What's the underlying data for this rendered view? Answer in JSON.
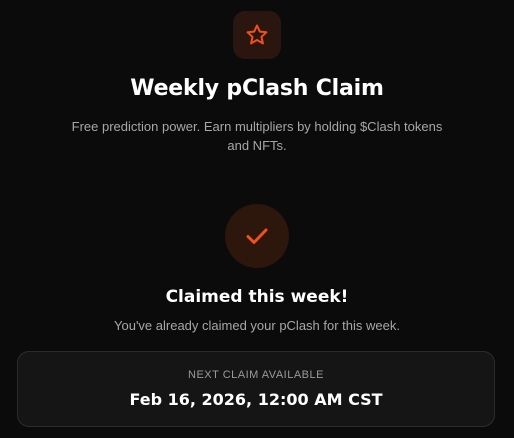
{
  "header": {
    "icon": "star-icon",
    "title": "Weekly pClash Claim",
    "subtitle": "Free prediction power. Earn multipliers by holding $Clash tokens and NFTs."
  },
  "status": {
    "icon": "checkmark-icon",
    "title": "Claimed this week!",
    "message": "You've already claimed your pClash for this week."
  },
  "next_claim": {
    "label": "NEXT CLAIM AVAILABLE",
    "value": "Feb 16, 2026, 12:00 AM CST"
  },
  "colors": {
    "accent": "#f0501e",
    "background": "#0b0b0b",
    "card_background": "#151515"
  }
}
